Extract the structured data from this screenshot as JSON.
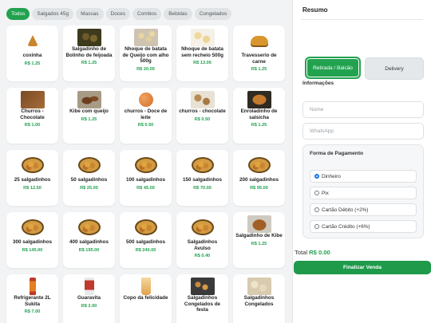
{
  "categories": [
    "Todos",
    "Salgados 45g",
    "Massas",
    "Doces",
    "Combos",
    "Bebidas",
    "Congelados"
  ],
  "products": [
    {
      "name": "coxinha",
      "price": "R$ 1.25",
      "img": "coxinha"
    },
    {
      "name": "Salgadinho de Bolinho de feijoada",
      "price": "R$ 1.25",
      "img": "bolinho"
    },
    {
      "name": "Nhoque de batata de Queijo com alho 500g",
      "price": "R$ 20.00",
      "img": "nhoque"
    },
    {
      "name": "Nhoque de batata sem recheio 500g",
      "price": "R$ 13.00",
      "img": "nhoque2"
    },
    {
      "name": "Travesserio de carne",
      "price": "R$ 1.25",
      "img": "trav"
    },
    {
      "name": "Churros - Chocolate",
      "price": "R$ 1.00",
      "img": "churros"
    },
    {
      "name": "Kibe com queijo",
      "price": "R$ 1.25",
      "img": "kibe"
    },
    {
      "name": "churros - Doce de leite",
      "price": "R$ 0.50",
      "img": "churros2"
    },
    {
      "name": "churros - chocolate",
      "price": "R$ 0.50",
      "img": "churros3"
    },
    {
      "name": "Enroladinho de salsicha",
      "price": "R$ 1.25",
      "img": "enrol"
    },
    {
      "name": "25 salgadinhos",
      "price": "R$ 12.50",
      "img": "combo"
    },
    {
      "name": "50 salgadinhos",
      "price": "R$ 25.00",
      "img": "combo"
    },
    {
      "name": "100 salgadinhos",
      "price": "R$ 45.00",
      "img": "combo"
    },
    {
      "name": "150 salgadinhos",
      "price": "R$ 70.00",
      "img": "combo"
    },
    {
      "name": "200 salgadinhos",
      "price": "R$ 95.00",
      "img": "combo"
    },
    {
      "name": "300 salgadinhos",
      "price": "R$ 145.00",
      "img": "combo"
    },
    {
      "name": "400 salgadinhos",
      "price": "R$ 195.00",
      "img": "combo"
    },
    {
      "name": "500 salgadinhos",
      "price": "R$ 240.00",
      "img": "combo"
    },
    {
      "name": "Salgadinhos Avulso",
      "price": "R$ 0.40",
      "img": "combo"
    },
    {
      "name": "Salgadinho de Kibe",
      "price": "R$ 1.25",
      "img": "kibe2"
    },
    {
      "name": "Refrigerante 2L Sukita",
      "price": "R$ 7.00",
      "img": "bottle"
    },
    {
      "name": "Guaravita",
      "price": "R$ 2.00",
      "img": "can"
    },
    {
      "name": "Copo da felicidade",
      "price": "",
      "img": "cup"
    },
    {
      "name": "Salgadinhos Congelados de festa",
      "price": "",
      "img": "congel"
    },
    {
      "name": "Salgadinhos Congelados",
      "price": "",
      "img": "congel2"
    }
  ],
  "sidebar": {
    "title": "Resumo",
    "tab_pickup": "Retirada / Balcão",
    "tab_delivery": "Delivery",
    "info_label": "Informações",
    "name_placeholder": "Nome",
    "whatsapp_placeholder": "WhatsApp",
    "payment_title": "Forma de Pagamento",
    "payment_options": [
      "Dinheiro",
      "Pix",
      "Cartão Débito (+2%)",
      "Cartão Crédito (+6%)"
    ],
    "total_label": "Total",
    "total_value": "R$ 0.00",
    "finish_label": "Finalizar Venda"
  },
  "colors": {
    "accent": "#22a24f",
    "button": "#1e9a4a"
  }
}
